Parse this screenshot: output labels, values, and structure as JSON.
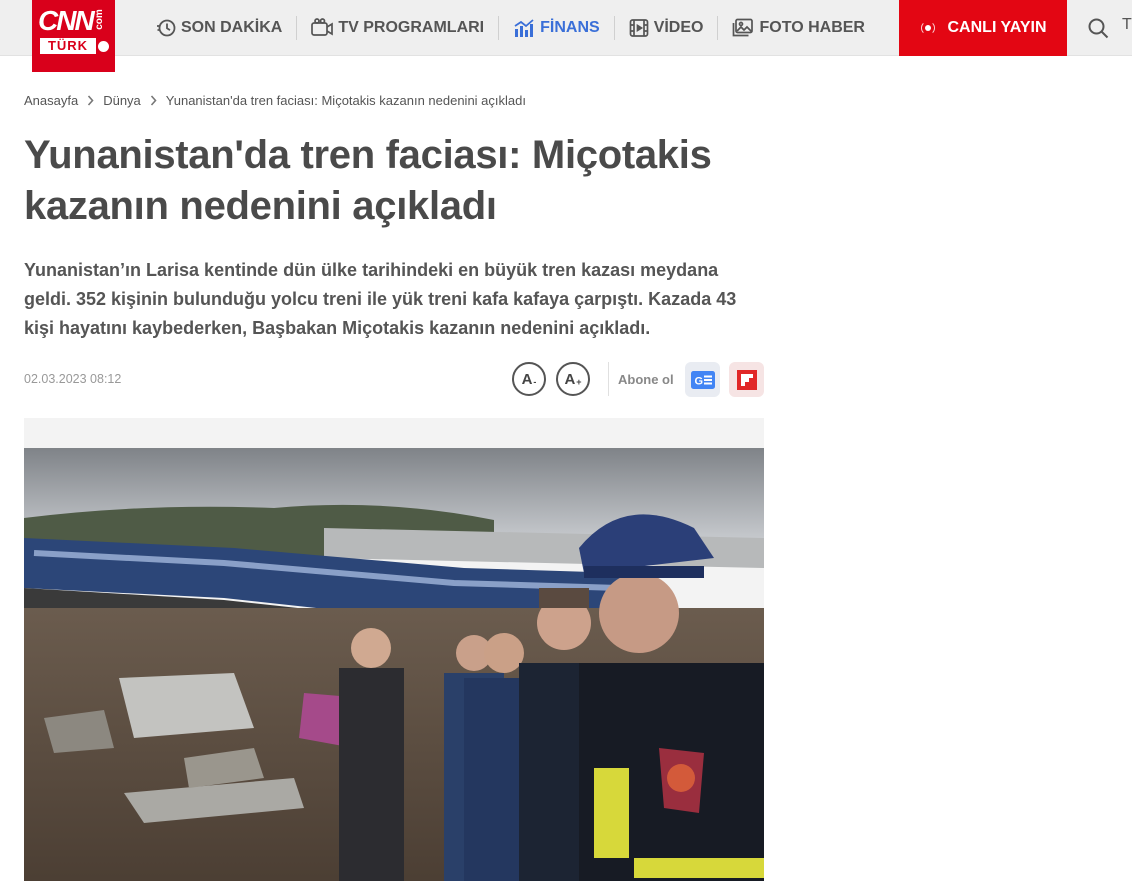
{
  "brand": {
    "logo_text": "CNN",
    "logo_sub": "TÜRK",
    "logo_com": "com"
  },
  "nav": {
    "items": [
      {
        "label": "SON DAKİKA",
        "icon": "breaking-news-icon"
      },
      {
        "label": "TV PROGRAMLARI",
        "icon": "tv-icon"
      },
      {
        "label": "FİNANS",
        "icon": "finance-chart-icon"
      },
      {
        "label": "VİDEO",
        "icon": "video-icon"
      },
      {
        "label": "FOTO HABER",
        "icon": "photo-gallery-icon"
      }
    ],
    "live_label": "CANLI YAYIN",
    "edge_glyph": "T"
  },
  "colors": {
    "brand_red": "#d9001b",
    "live_red": "#e30613",
    "finance_blue": "#3a6fd8",
    "title_gray": "#4a4a4a"
  },
  "breadcrumb": [
    "Anasayfa",
    "Dünya",
    "Yunanistan'da tren faciası: Miçotakis kazanın nedenini açıkladı"
  ],
  "article": {
    "title": "Yunanistan'da tren faciası: Miçotakis kazanın nedenini açıkladı",
    "lead": "Yunanistan’ın Larisa kentinde dün ülke tarihindeki en büyük tren kazası meydana geldi. 352 kişinin bulunduğu yolcu treni ile yük treni kafa kafaya çarpıştı. Kazada 43 kişi hayatını kaybederken, Başbakan Miçotakis kazanın nedenini açıkladı.",
    "date": "02.03.2023 08:12"
  },
  "tools": {
    "font_decrease": "A",
    "font_decrease_sign": "-",
    "font_increase": "A",
    "font_increase_sign": "+",
    "subscribe_label": "Abone ol",
    "google_news_icon": "google-news-icon",
    "flipboard_icon": "flipboard-icon"
  }
}
